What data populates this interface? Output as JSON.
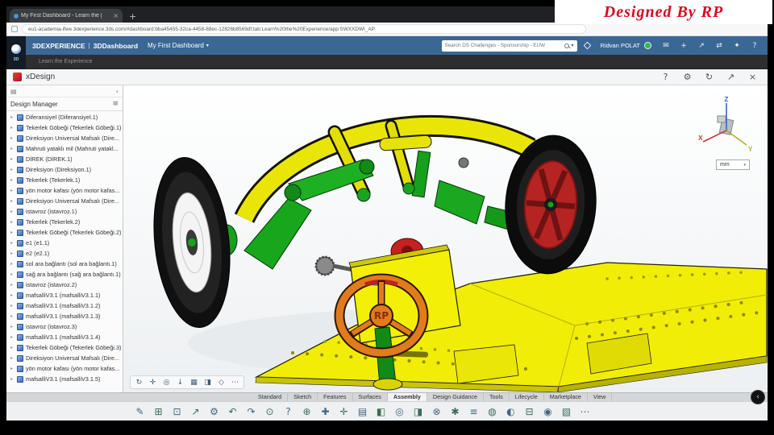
{
  "watermark": {
    "text": "Designed By RP"
  },
  "browser": {
    "tab_title": "My First Dashboard - Learn the  |",
    "close_glyph": "×",
    "new_tab_glyph": "+",
    "url": "eu1-academia-ifwe.3dexperience.3ds.com/#dashboard:bba45455-32ca-4458-88ec-12826b8569df;tab:Learn%20the%20Experience/app:SWXXDWI_AP"
  },
  "topbar": {
    "brand": "3DEXPERIENCE",
    "divider": "|",
    "app": "3DDashboard",
    "dashboard": "My First Dashboard",
    "caret": "▾",
    "brand_mark": "3D",
    "search_placeholder": "Search DS Challenges - Sponsorship - EUW",
    "user": "Ridvan POLAT",
    "icons": [
      {
        "name": "message-icon",
        "glyph": "✉"
      },
      {
        "name": "add-icon",
        "glyph": "+"
      },
      {
        "name": "share-icon",
        "glyph": "↗"
      },
      {
        "name": "community-icon",
        "glyph": "⇄"
      },
      {
        "name": "apps-icon",
        "glyph": "✦"
      },
      {
        "name": "help-icon",
        "glyph": "?"
      }
    ]
  },
  "dashstrip": {
    "tab": "Learn the Experience"
  },
  "app_header": {
    "title": "xDesign",
    "icons": [
      {
        "name": "help-icon",
        "glyph": "?"
      },
      {
        "name": "settings-icon",
        "glyph": "⚙"
      },
      {
        "name": "refresh-icon",
        "glyph": "↻"
      },
      {
        "name": "maximize-icon",
        "glyph": "↗"
      },
      {
        "name": "close-icon",
        "glyph": "×"
      }
    ]
  },
  "design_manager": {
    "panel_icon_glyph": "▤",
    "collapse_glyph": "‹",
    "title": "Design Manager",
    "menu_glyph": "≡",
    "items": [
      "Diferansiyel (Diferansiyel.1)",
      "Tekerlek Göbeği (Tekerlek Göbeği.1)",
      "Direksiyon Universal Mafsalı (Dire...",
      "Mahruti yataklı mil (Mahruti yatakl...",
      "DİREK (DİREK.1)",
      "Direksiyon (Direksiyon.1)",
      "Tekerlek (Tekerlek.1)",
      "yön motor kafası (yön motor kafas...",
      "Direksiyon Universal Mafsalı (Dire...",
      "istavroz (istavroz.1)",
      "Tekerlek (Tekerlek.2)",
      "Tekerlek Göbeği (Tekerlek Göbeği.2)",
      "e1 (e1.1)",
      "e2 (e2.1)",
      "sol ara bağlantı (sol ara bağlantı.1)",
      "sağ ara bağlantı (sağ ara bağlantı.1)",
      "istavroz (istavroz.2)",
      "mafsalliV3.1 (mafsalliV3.1.1)",
      "mafsalliV3.1 (mafsalliV3.1.2)",
      "mafsalliV3.1 (mafsalliV3.1.3)",
      "istavroz (istavroz.3)",
      "mafsalliV3.1 (mafsalliV3.1.4)",
      "Tekerlek Göbeği (Tekerlek Göbeği.3)",
      "Direksiyon Universal Mafsalı (Dire...",
      "yön motor kafası (yön motor kafas...",
      "mafsalliV3.1 (mafsalliV3.1.5)"
    ]
  },
  "icons": {
    "tree_expand": "▸",
    "caret": "▾",
    "fab_glyph": "‹"
  },
  "viewport": {
    "axes": {
      "x": "X",
      "y": "Y",
      "z": "Z"
    },
    "units": "mm",
    "steering_wheel_text": "RP",
    "toolbar": [
      {
        "name": "rotate-view-icon",
        "glyph": "↻"
      },
      {
        "name": "pan-icon",
        "glyph": "✛"
      },
      {
        "name": "zoom-fit-icon",
        "glyph": "◎"
      },
      {
        "name": "ground-view-icon",
        "glyph": "↓"
      },
      {
        "name": "grid-icon",
        "glyph": "▦"
      },
      {
        "name": "section-view-icon",
        "glyph": "◨"
      },
      {
        "name": "display-mode-icon",
        "glyph": "◇"
      },
      {
        "name": "more-tools-icon",
        "glyph": "⋯"
      }
    ]
  },
  "ribbon": {
    "tabs": [
      {
        "label": "Standard"
      },
      {
        "label": "Sketch"
      },
      {
        "label": "Features"
      },
      {
        "label": "Surfaces"
      },
      {
        "label": "Assembly",
        "active": true
      },
      {
        "label": "Design Guidance"
      },
      {
        "label": "Tools"
      },
      {
        "label": "Lifecycle"
      },
      {
        "label": "Marketplace"
      },
      {
        "label": "View"
      }
    ]
  },
  "action_bar": {
    "icons": [
      {
        "name": "design-icon",
        "glyph": "✎"
      },
      {
        "name": "insert-component-icon",
        "glyph": "⊞"
      },
      {
        "name": "save-icon",
        "glyph": "⊡"
      },
      {
        "name": "share-icon",
        "glyph": "↗"
      },
      {
        "name": "settings-icon",
        "glyph": "⚙"
      },
      {
        "name": "undo-icon",
        "glyph": "↶"
      },
      {
        "name": "redo-icon",
        "glyph": "↷"
      },
      {
        "name": "search-icon",
        "glyph": "⊙"
      },
      {
        "name": "help-icon",
        "glyph": "?"
      },
      {
        "name": "mate-icon",
        "glyph": "⊕"
      },
      {
        "name": "fastener-icon",
        "glyph": "✚"
      },
      {
        "name": "move-component-icon",
        "glyph": "✛"
      },
      {
        "name": "pattern-icon",
        "glyph": "▤"
      },
      {
        "name": "mirror-icon",
        "glyph": "◧"
      },
      {
        "name": "measure-icon",
        "glyph": "◎"
      },
      {
        "name": "section-icon",
        "glyph": "◨"
      },
      {
        "name": "interference-icon",
        "glyph": "⊗"
      },
      {
        "name": "explode-icon",
        "glyph": "✱"
      },
      {
        "name": "bom-icon",
        "glyph": "≡"
      },
      {
        "name": "appearance-icon",
        "glyph": "◍"
      },
      {
        "name": "display-style-icon",
        "glyph": "◐"
      },
      {
        "name": "print-icon",
        "glyph": "⊟"
      },
      {
        "name": "camera-icon",
        "glyph": "◉"
      },
      {
        "name": "views-icon",
        "glyph": "▧"
      },
      {
        "name": "more-icon",
        "glyph": "⋯"
      }
    ]
  },
  "colors": {
    "topbar_blue": "#3b6795",
    "chassis_yellow": "#f1ed06",
    "part_green": "#17a61c",
    "wheel_orange": "#e07b1e",
    "watermark_red": "#d40a20"
  }
}
